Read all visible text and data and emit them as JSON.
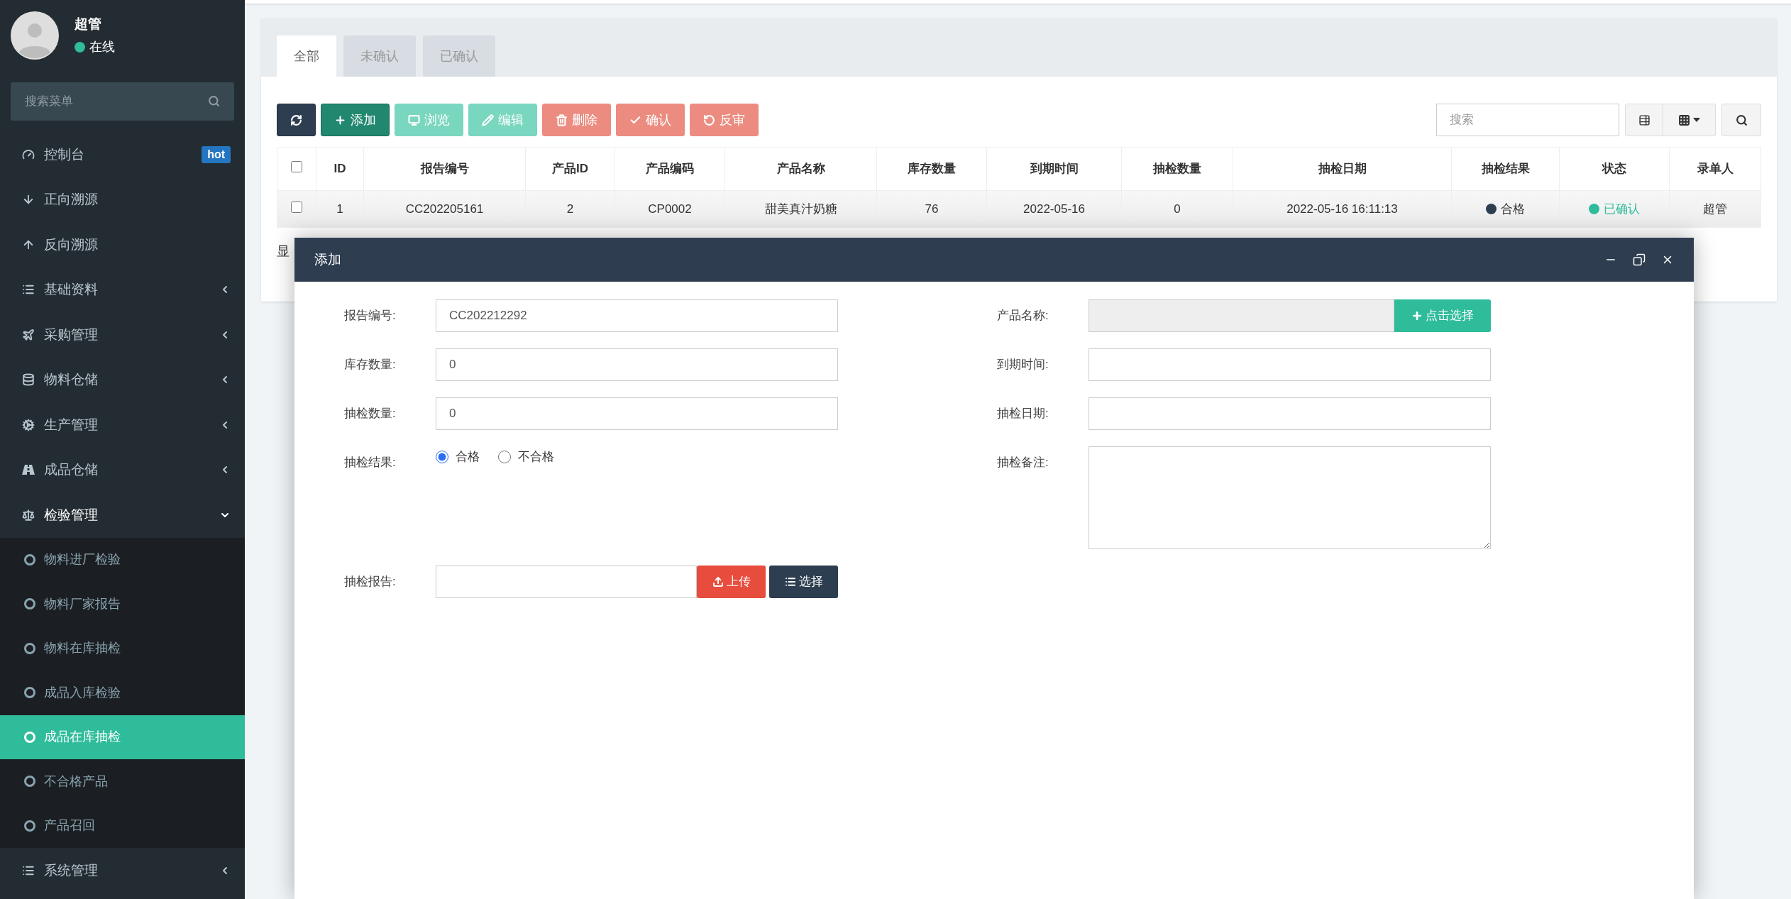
{
  "user": {
    "name": "超管",
    "status": "在线"
  },
  "sidebar": {
    "search": {
      "placeholder": "搜索菜单"
    },
    "items": [
      {
        "label": "控制台",
        "badge": "hot"
      },
      {
        "label": "正向溯源"
      },
      {
        "label": "反向溯源"
      },
      {
        "label": "基础资料",
        "expanded": false
      },
      {
        "label": "采购管理",
        "expanded": false
      },
      {
        "label": "物料仓储",
        "expanded": false
      },
      {
        "label": "生产管理",
        "expanded": false
      },
      {
        "label": "成品仓储",
        "expanded": false
      },
      {
        "label": "检验管理",
        "expanded": true,
        "children": [
          {
            "label": "物料进厂检验",
            "selected": false
          },
          {
            "label": "物料厂家报告",
            "selected": false
          },
          {
            "label": "物料在库抽检",
            "selected": false
          },
          {
            "label": "成品入库检验",
            "selected": false
          },
          {
            "label": "成品在库抽检",
            "selected": true
          },
          {
            "label": "不合格产品",
            "selected": false
          },
          {
            "label": "产品召回",
            "selected": false
          }
        ]
      },
      {
        "label": "系统管理",
        "expanded": false
      }
    ]
  },
  "tabs": [
    {
      "label": "全部",
      "selected": true
    },
    {
      "label": "未确认",
      "selected": false
    },
    {
      "label": "已确认",
      "selected": false
    }
  ],
  "toolbar": {
    "buttons": [
      {
        "kind": "dark",
        "disabled": false
      },
      {
        "label": "添加",
        "kind": "success",
        "disabled": false
      },
      {
        "label": "浏览",
        "kind": "success",
        "disabled": true
      },
      {
        "label": "编辑",
        "kind": "success",
        "disabled": true
      },
      {
        "label": "删除",
        "kind": "danger",
        "disabled": true
      },
      {
        "label": "确认",
        "kind": "danger",
        "disabled": true
      },
      {
        "label": "反审",
        "kind": "danger",
        "disabled": true
      }
    ],
    "search": {
      "placeholder": "搜索"
    }
  },
  "table": {
    "checked": false,
    "columns": [
      "ID",
      "报告编号",
      "产品ID",
      "产品编码",
      "产品名称",
      "库存数量",
      "到期时间",
      "抽检数量",
      "抽检日期",
      "抽检结果",
      "状态",
      "录单人"
    ],
    "rows": [
      {
        "checked": false,
        "cells": [
          {
            "text": "1"
          },
          {
            "text": "CC202205161"
          },
          {
            "text": "2"
          },
          {
            "text": "CP0002"
          },
          {
            "text": "甜美真汁奶糖"
          },
          {
            "text": "76"
          },
          {
            "text": "2022-05-16"
          },
          {
            "text": "0"
          },
          {
            "text": "2022-05-16 16:11:13"
          },
          {
            "text": "合格",
            "color": "#2c3e50"
          },
          {
            "text": "已确认",
            "color": "#2fbc9b"
          },
          {
            "text": "超管"
          }
        ]
      }
    ]
  },
  "footer": "显",
  "dialog": {
    "title": "添加",
    "fields": [
      {
        "kind": "text",
        "label": "报告编号:",
        "value": "CC202212292"
      },
      {
        "kind": "picker",
        "label": "产品名称:",
        "button": "点击选择"
      },
      {
        "kind": "text",
        "label": "库存数量:",
        "value": "0"
      },
      {
        "kind": "text",
        "label": "到期时间:"
      },
      {
        "kind": "text",
        "label": "抽检数量:",
        "value": "0"
      },
      {
        "kind": "text",
        "label": "抽检日期:"
      },
      {
        "kind": "radio",
        "label": "抽检结果:",
        "options": [
          {
            "label": "合格",
            "selected": true
          },
          {
            "label": "不合格",
            "selected": false
          }
        ]
      },
      {
        "kind": "textarea",
        "label": "抽检备注:"
      },
      {
        "kind": "file",
        "label": "抽检报告:",
        "buttons": [
          "上传",
          "选择"
        ]
      }
    ]
  }
}
